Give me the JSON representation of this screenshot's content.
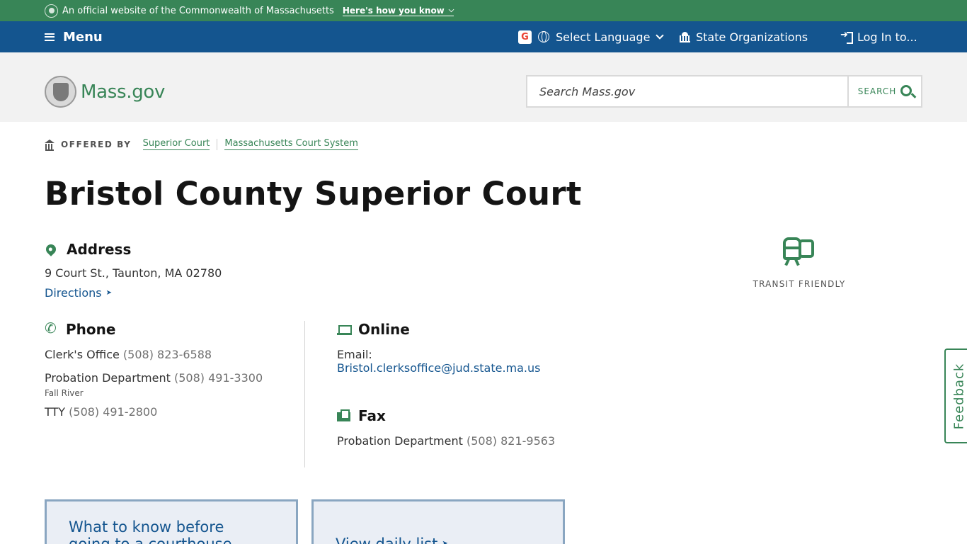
{
  "banner": {
    "text": "An official website of the Commonwealth of Massachusetts",
    "how_you_know": "Here's how you know"
  },
  "utility_nav": {
    "menu_label": "Menu",
    "language_label": "Select Language",
    "state_orgs_label": "State Organizations",
    "login_label": "Log In to..."
  },
  "header": {
    "logo_text": "Mass.gov",
    "search_placeholder": "Search Mass.gov",
    "search_button": "SEARCH"
  },
  "offered_by": {
    "label": "OFFERED BY",
    "orgs": [
      "Superior Court",
      "Massachusetts Court System"
    ]
  },
  "page_title": "Bristol County Superior Court",
  "address": {
    "heading": "Address",
    "line": "9 Court St., Taunton, MA 02780",
    "directions": "Directions"
  },
  "transit": {
    "label": "TRANSIT FRIENDLY"
  },
  "phone": {
    "heading": "Phone",
    "entries": [
      {
        "label": "Clerk's Office",
        "number": "(508) 823-6588",
        "note": ""
      },
      {
        "label": "Probation Department",
        "number": "(508) 491-3300",
        "note": "Fall River"
      },
      {
        "label": "TTY",
        "number": "(508) 491-2800",
        "note": ""
      }
    ]
  },
  "online": {
    "heading": "Online",
    "email_label": "Email:",
    "email": "Bristol.clerksoffice@jud.state.ma.us"
  },
  "fax": {
    "heading": "Fax",
    "label": "Probation Department",
    "number": "(508) 821-9563"
  },
  "cards": [
    {
      "text": "What to know before going to a courthouse"
    },
    {
      "text": "View daily list"
    }
  ],
  "feedback_label": "Feedback",
  "colors": {
    "green": "#388557",
    "blue": "#14558f",
    "header_bg": "#f2f2f2"
  }
}
